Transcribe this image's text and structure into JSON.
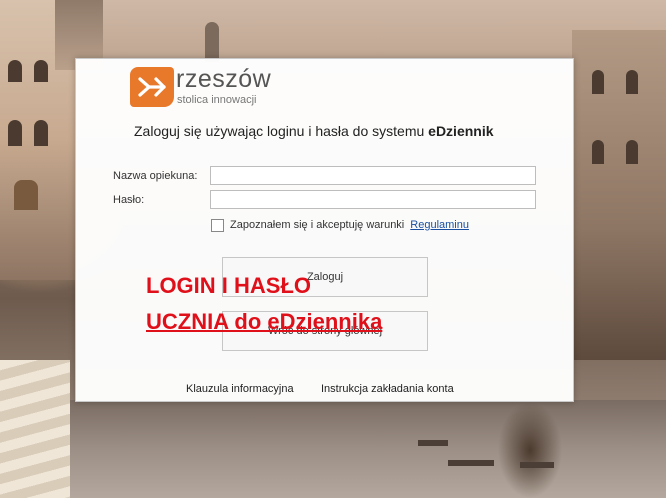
{
  "logo": {
    "name": "rzeszów",
    "tagline": "stolica innowacji"
  },
  "login": {
    "heading_prefix": "Zaloguj się używając loginu i hasła do systemu ",
    "heading_system": "eDziennik",
    "guardian_label": "Nazwa opiekuna:",
    "password_label": "Hasło:",
    "terms_text": "Zapoznałem się i akceptuję warunki",
    "terms_link": "Regulaminu",
    "login_button": "Zaloguj",
    "back_button": "Wróć do strony głównej"
  },
  "overlay": {
    "line1": "LOGIN I HASŁO",
    "line2": "UCZNIA do eDziennika"
  },
  "footer": {
    "privacy_clause": "Klauzula informacyjna",
    "account_instructions": "Instrukcja zakładania konta"
  },
  "colors": {
    "brand_orange": "#e8782a",
    "overlay_red": "#e0101a",
    "link_blue": "#1a4fa0"
  }
}
